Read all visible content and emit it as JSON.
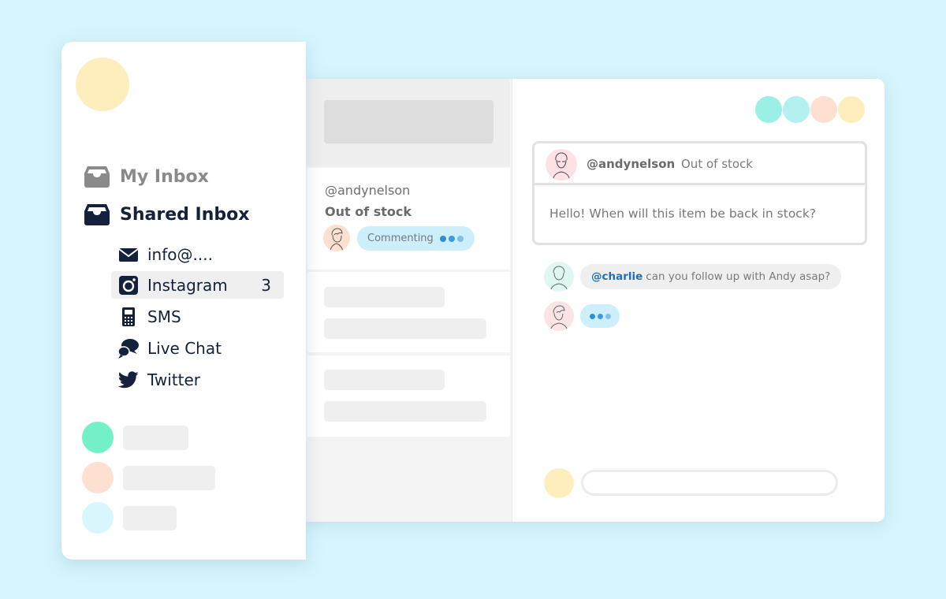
{
  "sidebar": {
    "logo_color": "#ffeebd",
    "nav": [
      {
        "label": "My Inbox",
        "icon": "inbox-icon"
      },
      {
        "label": "Shared Inbox",
        "icon": "inbox-icon"
      }
    ],
    "channels": [
      {
        "label": "info@....",
        "icon": "envelope-icon",
        "count": null,
        "active": false
      },
      {
        "label": "Instagram",
        "icon": "instagram-icon",
        "count": "3",
        "active": true
      },
      {
        "label": "SMS",
        "icon": "phone-icon",
        "count": null,
        "active": false
      },
      {
        "label": "Live Chat",
        "icon": "chat-bubbles-icon",
        "count": null,
        "active": false
      },
      {
        "label": "Twitter",
        "icon": "twitter-icon",
        "count": null,
        "active": false
      }
    ],
    "members": [
      {
        "color": "#74f0c8"
      },
      {
        "color": "#fde0cf"
      },
      {
        "color": "#d8f6fc"
      }
    ]
  },
  "conversation_list": {
    "selected": {
      "user": "@andynelson",
      "subject": "Out of stock",
      "status": "Commenting"
    }
  },
  "chat": {
    "participants": [
      "#9af0e4",
      "#b3f0f0",
      "#fde0cf",
      "#ffeebd"
    ],
    "message": {
      "user": "@andynelson",
      "subject": "Out of stock",
      "body": "Hello! When will this item be back in stock?"
    },
    "comments": [
      {
        "mention": "@charlie",
        "text": "can you follow up with Andy asap?"
      }
    ],
    "typing": true,
    "composer": {
      "placeholder": "",
      "value": ""
    }
  },
  "colors": {
    "background": "#d6f5fc",
    "accent_blue": "#2c8fd6",
    "text_dark": "#13213d",
    "mention": "#1f6fb8",
    "typing_pill": "#cdeefb"
  }
}
